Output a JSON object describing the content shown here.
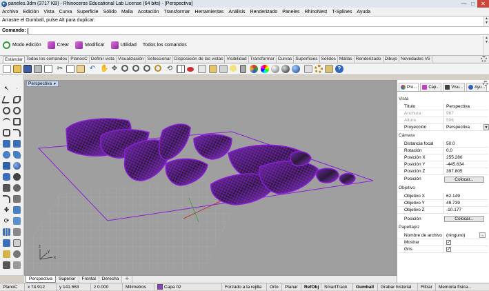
{
  "window": {
    "title": "paneles.3dm (3717 KB) - Rhinoceros Educational Lab License (64 bits) - [Perspectiva]",
    "min_label": "—",
    "max_label": "□",
    "close_label": "✕"
  },
  "menu": [
    "Archivo",
    "Edición",
    "Vista",
    "Curva",
    "Superficie",
    "Sólido",
    "Malla",
    "Acotación",
    "Transformar",
    "Herramientas",
    "Análisis",
    "Renderizado",
    "Paneles",
    "RhinoNest",
    "T-Splines",
    "Ayuda"
  ],
  "command": {
    "history": "Arrastre el Gumball, pulse Alt para duplicar:",
    "prompt_label": "Comando:",
    "input_value": ""
  },
  "quickbar": [
    {
      "label": "Modo edición",
      "icon": "power-icon",
      "color": "#2f9a3a"
    },
    {
      "label": "Crear",
      "icon": "create-icon",
      "color": "#b03ab0"
    },
    {
      "label": "Modificar",
      "icon": "modify-icon",
      "color": "#b03ab0"
    },
    {
      "label": "Utilidad",
      "icon": "utility-icon",
      "color": "#b03ab0"
    },
    {
      "label": "Todos los comandos",
      "icon": "all-commands-icon",
      "color": "#b03ab0"
    }
  ],
  "toolbar_tabs": [
    "Estándar",
    "Todos los comandos",
    "PlanosC",
    "Definir vista",
    "Visualización",
    "Seleccionar",
    "Disposición de las vistas",
    "Visibilidad",
    "Transformar",
    "Curvas",
    "Superficies",
    "Sólidos",
    "Mallas",
    "Renderizado",
    "Dibujo",
    "Novedades V5"
  ],
  "viewport": {
    "name": "Perspectiva",
    "dropdown": "▼",
    "axis_x": "x",
    "axis_y": "y",
    "axis_z": "z",
    "highlight_color": "#8a1fd6"
  },
  "viewport_tabs": [
    "Perspectiva",
    "Superior",
    "Frontal",
    "Derecha"
  ],
  "viewport_add": "✛",
  "panel": {
    "tabs": [
      {
        "label": "Pro...",
        "color": "#d04040"
      },
      {
        "label": "Cap...",
        "color": "#c040c0"
      },
      {
        "label": "Visu...",
        "color": "#404040"
      },
      {
        "label": "Ayu...",
        "color": "#3060c0"
      }
    ],
    "sections": {
      "vista": "Vista",
      "camara": "Cámara",
      "objetivo": "Objetivo",
      "papeltapiz": "Papeltapiz"
    },
    "vista_rows": [
      {
        "k": "Título",
        "v": "Perspectiva",
        "gray": false
      },
      {
        "k": "Anchura",
        "v": "967",
        "gray": true
      },
      {
        "k": "Altura",
        "v": "506",
        "gray": true
      },
      {
        "k": "Proyección",
        "v": "Perspectiva",
        "gray": false
      }
    ],
    "camara_rows": [
      {
        "k": "Distancia focal",
        "v": "50.0"
      },
      {
        "k": "Rotación",
        "v": "0.0"
      },
      {
        "k": "Posición X",
        "v": "255.280"
      },
      {
        "k": "Posición Y",
        "v": "-445.634"
      },
      {
        "k": "Posición Z",
        "v": "397.805"
      }
    ],
    "camara_pos_label": "Posición",
    "objetivo_rows": [
      {
        "k": "Objetivo X",
        "v": "62.149"
      },
      {
        "k": "Objetivo Y",
        "v": "49.739"
      },
      {
        "k": "Objetivo Z",
        "v": "-10.177"
      }
    ],
    "objetivo_pos_label": "Posición",
    "colocar_label": "Colocar...",
    "papeltapiz_rows": [
      {
        "k": "Nombre de archivo",
        "v": "(ninguno)"
      },
      {
        "k": "Mostrar",
        "v": ""
      },
      {
        "k": "Gris",
        "v": ""
      }
    ]
  },
  "status": {
    "plane": "PlanoC",
    "x": "x 74.912",
    "y": "y 141.563",
    "z": "z 0.000",
    "units": "Milímetros",
    "layer": "Capa 02",
    "layer_color": "#8e3bd0",
    "toggles": [
      "Forzado a la rejilla",
      "Orto",
      "Planar",
      "RefObj",
      "SmartTrack",
      "Gumball",
      "Grabar historial",
      "Filtrar",
      "Memoria física..."
    ]
  }
}
